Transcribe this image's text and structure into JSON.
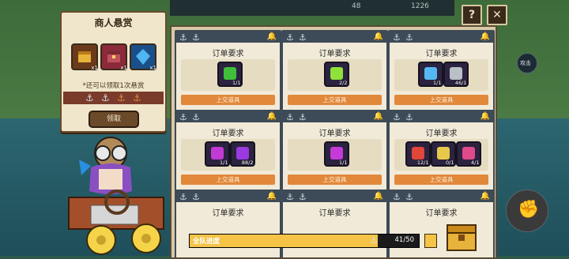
{
  "top_bar": {
    "coin_value": "48",
    "gem_value": "1226"
  },
  "reward_panel": {
    "title": "商人悬赏",
    "items": [
      {
        "icon": "gold-gear-chest",
        "count": "x1"
      },
      {
        "icon": "treasure-chest",
        "count": "x1"
      },
      {
        "icon": "blue-gem",
        "count": "x1"
      }
    ],
    "note": "*还可以领取1次悬赏",
    "claim_label": "领取"
  },
  "orders": [
    {
      "title": "订单要求",
      "submit_label": "上交道具",
      "items": [
        {
          "icon": "green-boots",
          "count": "1/1",
          "color": "#3fbf3a"
        }
      ]
    },
    {
      "title": "订单要求",
      "submit_label": "上交道具",
      "items": [
        {
          "icon": "green-shirt",
          "count": "2/2",
          "color": "#8fe23a"
        }
      ]
    },
    {
      "title": "订单要求",
      "submit_label": "上交道具",
      "items": [
        {
          "icon": "blue-potion",
          "count": "1/1",
          "color": "#56b8f2"
        },
        {
          "icon": "gray-armor",
          "count": "46/1",
          "color": "#b9c0c6"
        }
      ]
    },
    {
      "title": "订单要求",
      "submit_label": "上交道具",
      "items": [
        {
          "icon": "purple-gem",
          "count": "1/1",
          "color": "#c23ad4"
        },
        {
          "icon": "purple-bracelet",
          "count": "88/2",
          "color": "#9b3ae0"
        }
      ]
    },
    {
      "title": "订单要求",
      "submit_label": "上交道具",
      "items": [
        {
          "icon": "purple-flower",
          "count": "1/1",
          "color": "#c43ad9"
        }
      ]
    },
    {
      "title": "订单要求",
      "submit_label": "上交道具",
      "items": [
        {
          "icon": "red-crab",
          "count": "12/1",
          "color": "#e0463a"
        },
        {
          "icon": "gold-ring",
          "count": "0/1",
          "color": "#e6c94a"
        },
        {
          "icon": "pink-flower",
          "count": "4/1",
          "color": "#e04a8a"
        }
      ]
    },
    {
      "title": "订单要求",
      "submit_label": "",
      "items": []
    },
    {
      "title": "订单要求",
      "submit_label": "",
      "items": []
    },
    {
      "title": "订单要求",
      "submit_label": "",
      "items": []
    }
  ],
  "progress": {
    "label": "全队进度",
    "count": "41/50",
    "fraction": 0.82
  },
  "side": {
    "attack_label": "攻击"
  }
}
